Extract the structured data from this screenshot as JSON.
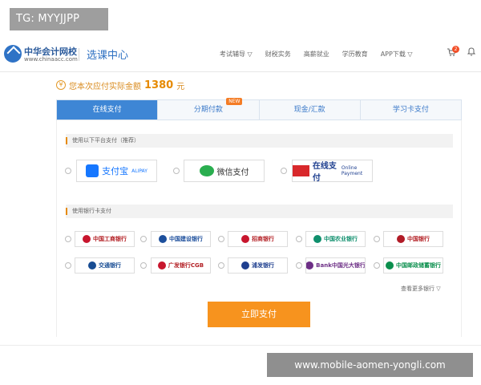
{
  "tag": {
    "text": "TG: MYYJJPP"
  },
  "header": {
    "brand_name": "中华会计网校",
    "brand_url": "www.chinaacc.com",
    "section_title": "选课中心",
    "nav": [
      {
        "label": "考试辅导 ▽"
      },
      {
        "label": "财税实务"
      },
      {
        "label": "高薪就业"
      },
      {
        "label": "学历教育"
      },
      {
        "label": "APP下载 ▽"
      }
    ],
    "cart_count": "2"
  },
  "amount": {
    "label": "您本次应付实际金额",
    "value": "1380",
    "unit": "元"
  },
  "tabs": [
    {
      "label": "在线支付"
    },
    {
      "label": "分期付款"
    },
    {
      "label": "现金/汇款"
    },
    {
      "label": "学习卡支付"
    }
  ],
  "tab_badge": "NEW",
  "platform_section": {
    "label": "使用以下平台支付（推荐）"
  },
  "platforms": [
    {
      "label": "支付宝",
      "sub": "ALIPAY",
      "color": "#1677ff"
    },
    {
      "label": "微信支付",
      "color": "#2aae4f"
    },
    {
      "label": "在线支付",
      "sub": "Online Payment",
      "color": "#d8282b"
    }
  ],
  "bank_section": {
    "label": "使用银行卡支付"
  },
  "banks": [
    {
      "label": "中国工商银行",
      "color": "#c8152d"
    },
    {
      "label": "中国建设银行",
      "color": "#1d4f9c"
    },
    {
      "label": "招商银行",
      "color": "#c8152d"
    },
    {
      "label": "中国农业银行",
      "color": "#0f8f6d"
    },
    {
      "label": "中国银行",
      "color": "#b11b27"
    },
    {
      "label": "交通银行",
      "color": "#174c93"
    },
    {
      "label": "广发银行CGB",
      "color": "#c8152d"
    },
    {
      "label": "浦发银行",
      "color": "#1e3f8f"
    },
    {
      "label": "Bank中国光大银行",
      "color": "#6d2f86"
    },
    {
      "label": "中国邮政储蓄银行",
      "color": "#0b8f4d"
    }
  ],
  "more_banks": "查看更多银行 ▽",
  "pay_button": "立即支付",
  "watermark": "www.mobile-aomen-yongli.com"
}
